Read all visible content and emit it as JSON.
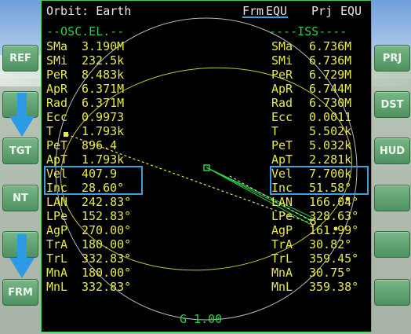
{
  "header": {
    "title": "Orbit: Earth",
    "frm_label": "Frm",
    "frm_value": "EQU",
    "prj_label": "Prj",
    "prj_value": "EQU"
  },
  "left_panel": {
    "heading": "--OSC.EL.--",
    "rows": [
      {
        "label": "SMa",
        "value": "3.190M"
      },
      {
        "label": "SMi",
        "value": "232.5k"
      },
      {
        "label": "PeR",
        "value": "8.483k"
      },
      {
        "label": "ApR",
        "value": "6.371M"
      },
      {
        "label": "Rad",
        "value": "6.371M"
      },
      {
        "label": "Ecc",
        "value": "0.9973"
      },
      {
        "label": "T",
        "value": "1.793k"
      },
      {
        "label": "PeT",
        "value": "896.4"
      },
      {
        "label": "ApT",
        "value": "1.793k"
      },
      {
        "label": "Vel",
        "value": "407.9"
      },
      {
        "label": "Inc",
        "value": "28.60°"
      },
      {
        "label": "LAN",
        "value": "242.83°"
      },
      {
        "label": "LPe",
        "value": "152.83°"
      },
      {
        "label": "AgP",
        "value": "270.00°"
      },
      {
        "label": "TrA",
        "value": "180.00°"
      },
      {
        "label": "TrL",
        "value": "332.83°"
      },
      {
        "label": "MnA",
        "value": "180.00°"
      },
      {
        "label": "MnL",
        "value": "332.83°"
      }
    ]
  },
  "right_panel": {
    "heading": "----ISS----",
    "rows": [
      {
        "label": "SMa",
        "value": "6.736M"
      },
      {
        "label": "SMi",
        "value": "6.736M"
      },
      {
        "label": "PeR",
        "value": "6.729M"
      },
      {
        "label": "ApR",
        "value": "6.744M"
      },
      {
        "label": "Rad",
        "value": "6.730M"
      },
      {
        "label": "Ecc",
        "value": "0.0011"
      },
      {
        "label": "T",
        "value": "5.502k"
      },
      {
        "label": "PeT",
        "value": "5.032k"
      },
      {
        "label": "ApT",
        "value": "2.281k"
      },
      {
        "label": "Vel",
        "value": "7.700k"
      },
      {
        "label": "Inc",
        "value": "51.58°"
      },
      {
        "label": "LAN",
        "value": "166.04°"
      },
      {
        "label": "LPe",
        "value": "328.63°"
      },
      {
        "label": "AgP",
        "value": "161.99°"
      },
      {
        "label": "TrA",
        "value": "30.82°"
      },
      {
        "label": "TrL",
        "value": "359.45°"
      },
      {
        "label": "MnA",
        "value": "30.75°"
      },
      {
        "label": "MnL",
        "value": "359.38°"
      }
    ]
  },
  "footer": {
    "scale": "G 1.00"
  },
  "left_buttons": [
    "REF",
    "",
    "TGT",
    "NT",
    "",
    "FRM"
  ],
  "right_buttons": [
    "PRJ",
    "DST",
    "HUD",
    "",
    "",
    ""
  ],
  "colors": {
    "yellow": "#e8e84a",
    "green": "#2fcf45",
    "white": "#e6e6e6",
    "highlight": "#3d9fe0"
  }
}
